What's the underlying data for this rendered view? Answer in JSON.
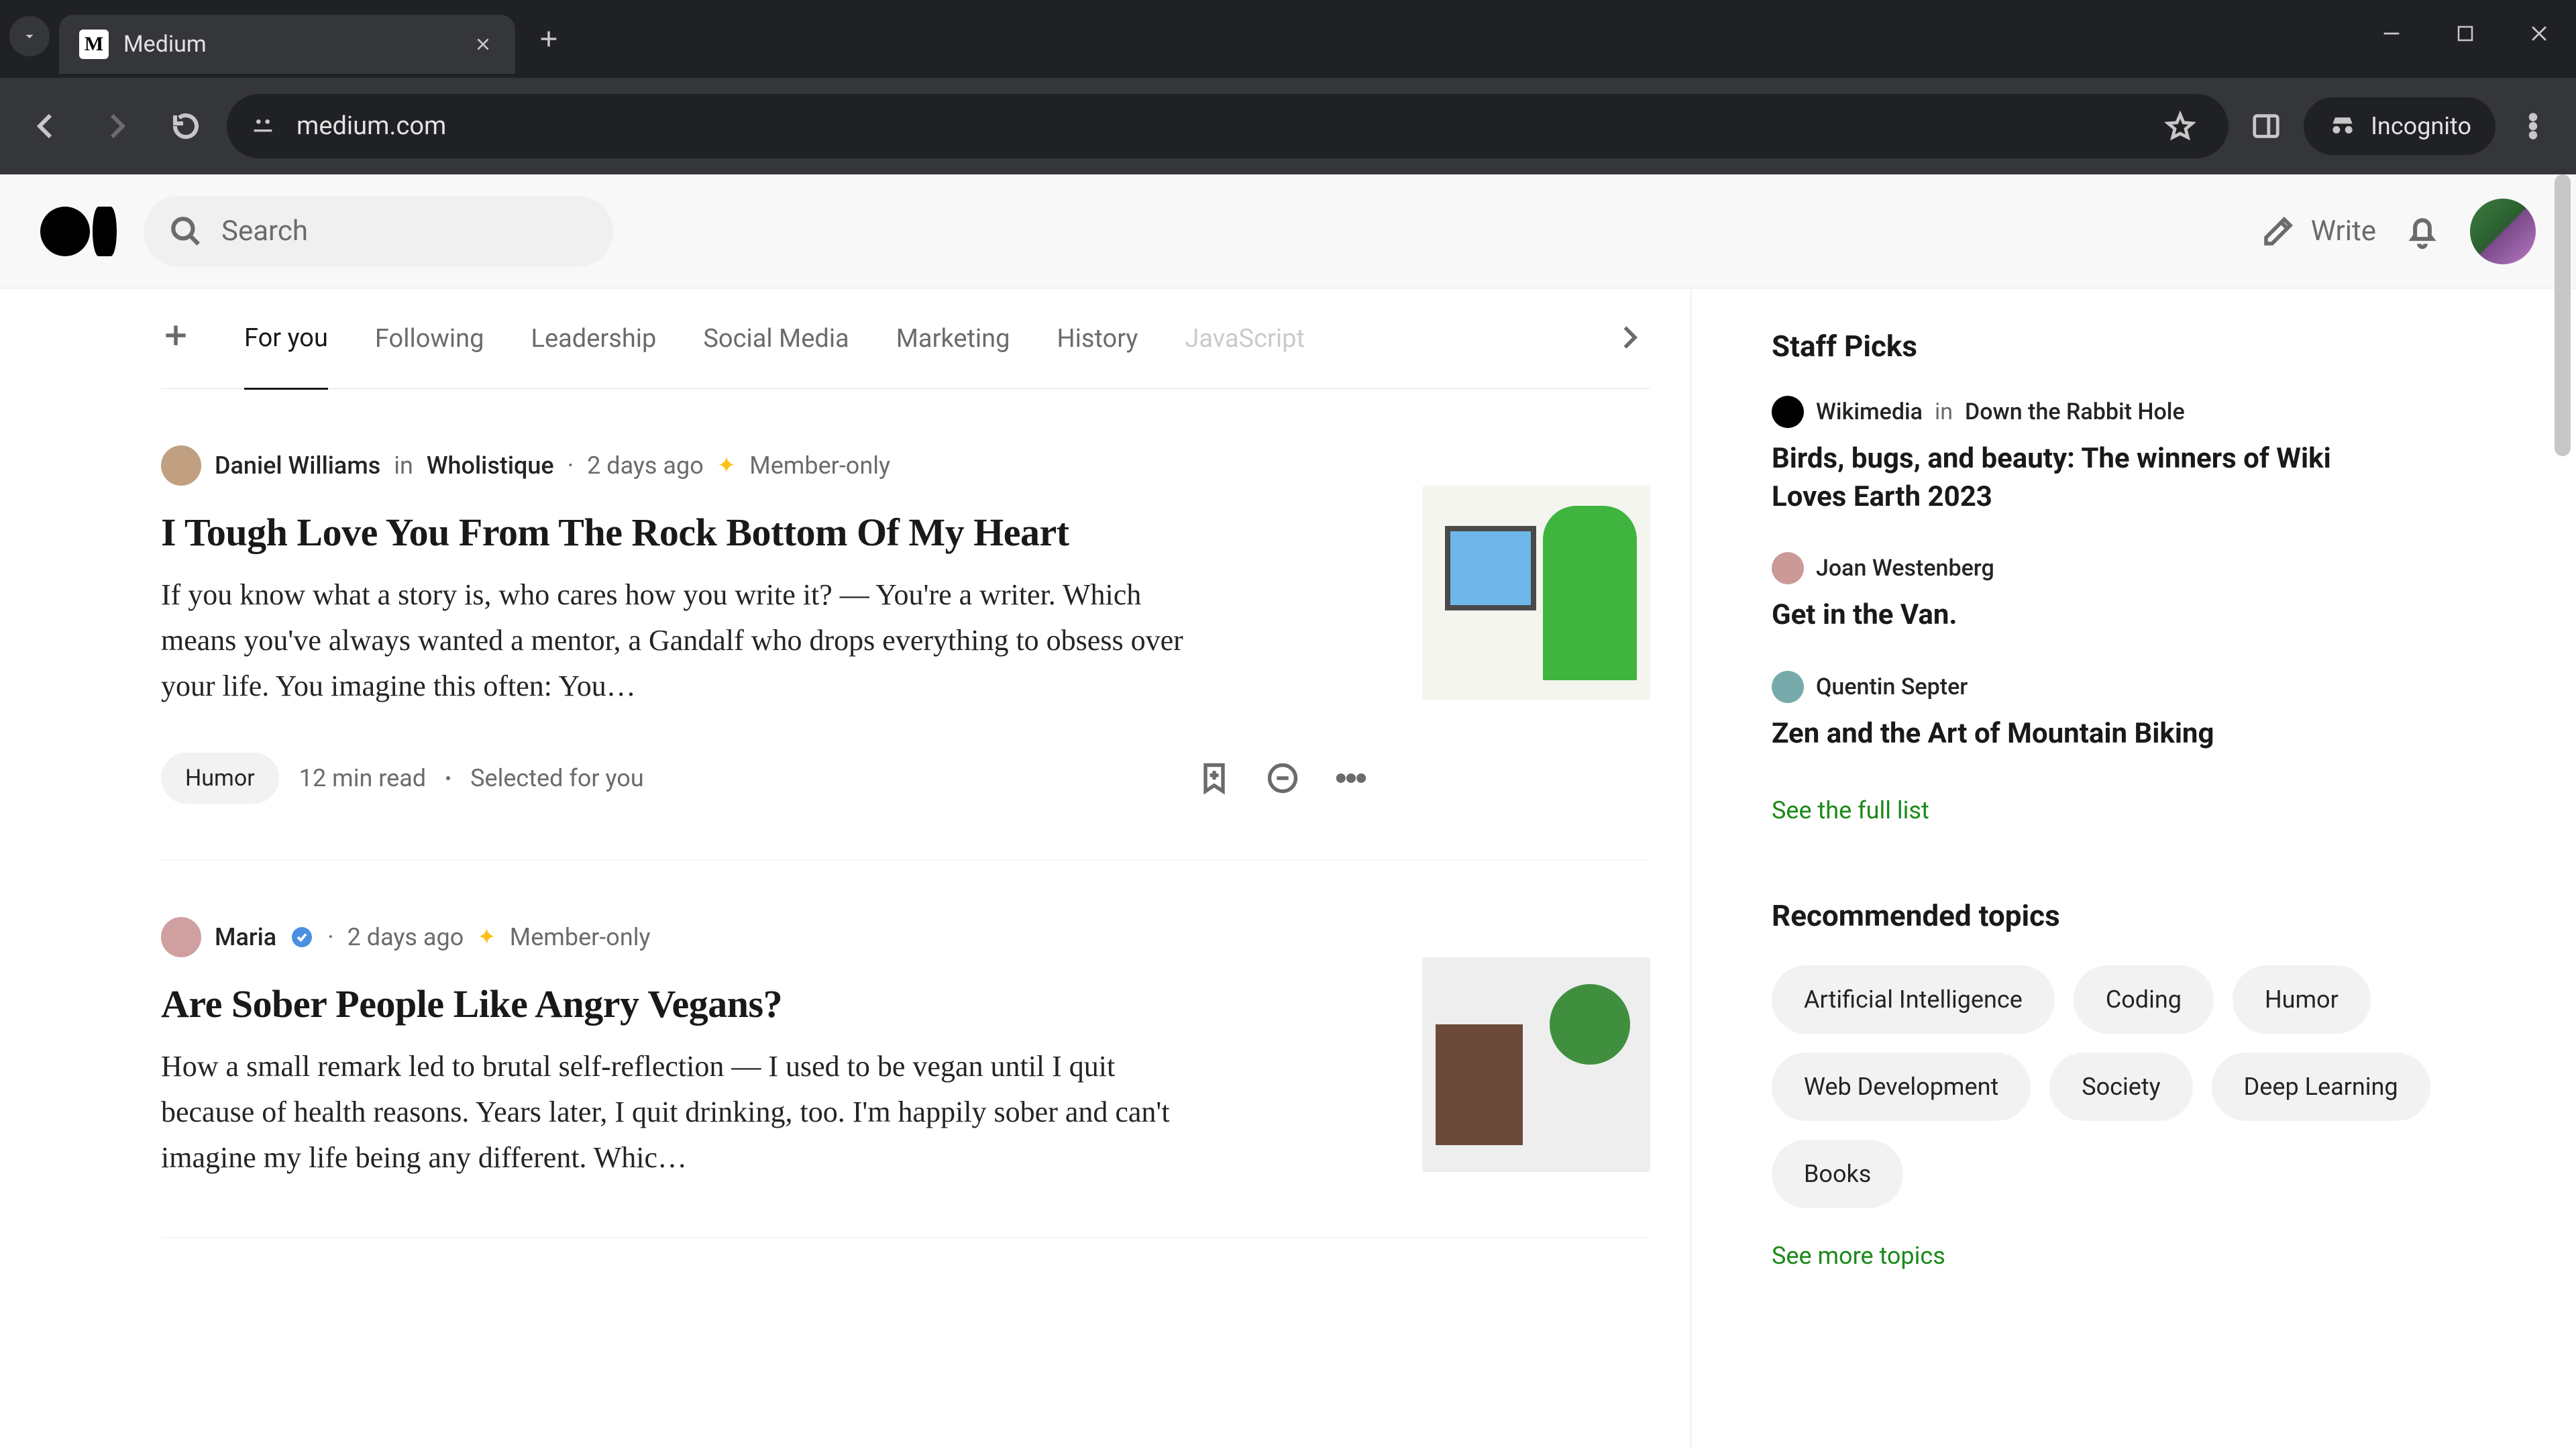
{
  "browser": {
    "tab_title": "Medium",
    "url": "medium.com",
    "incognito_label": "Incognito"
  },
  "header": {
    "search_placeholder": "Search",
    "write_label": "Write"
  },
  "feed_tabs": {
    "items": [
      "For you",
      "Following",
      "Leadership",
      "Social Media",
      "Marketing",
      "History",
      "JavaScript"
    ],
    "active_index": 0
  },
  "articles": [
    {
      "author": "Daniel Williams",
      "in_word": "in",
      "publication": "Wholistique",
      "age": "2 days ago",
      "member_only": "Member-only",
      "title": "I Tough Love You From The Rock Bottom Of My Heart",
      "snippet": "If you know what a story is, who cares how you write it? — You're a writer. Which means you've always wanted a mentor, a Gandalf who drops everything to obsess over your life. You imagine this often: You…",
      "tag": "Humor",
      "read_time": "12 min read",
      "selected": "Selected for you",
      "verified": false
    },
    {
      "author": "Maria",
      "in_word": "",
      "publication": "",
      "age": "2 days ago",
      "member_only": "Member-only",
      "title": "Are Sober People Like Angry Vegans?",
      "snippet": "How a small remark led to brutal self-reflection — I used to be vegan until I quit because of health reasons. Years later, I quit drinking, too. I'm happily sober and can't imagine my life being any different. Whic…",
      "tag": "",
      "read_time": "",
      "selected": "",
      "verified": true
    }
  ],
  "staff_picks": {
    "heading": "Staff Picks",
    "items": [
      {
        "author": "Wikimedia",
        "in_word": "in",
        "publication": "Down the Rabbit Hole",
        "title": "Birds, bugs, and beauty: The winners of Wiki Loves Earth 2023"
      },
      {
        "author": "Joan Westenberg",
        "in_word": "",
        "publication": "",
        "title": "Get in the Van."
      },
      {
        "author": "Quentin Septer",
        "in_word": "",
        "publication": "",
        "title": "Zen and the Art of Mountain Biking"
      }
    ],
    "see_all": "See the full list"
  },
  "topics": {
    "heading": "Recommended topics",
    "items": [
      "Artificial Intelligence",
      "Coding",
      "Humor",
      "Web Development",
      "Society",
      "Deep Learning",
      "Books"
    ],
    "see_more": "See more topics"
  }
}
